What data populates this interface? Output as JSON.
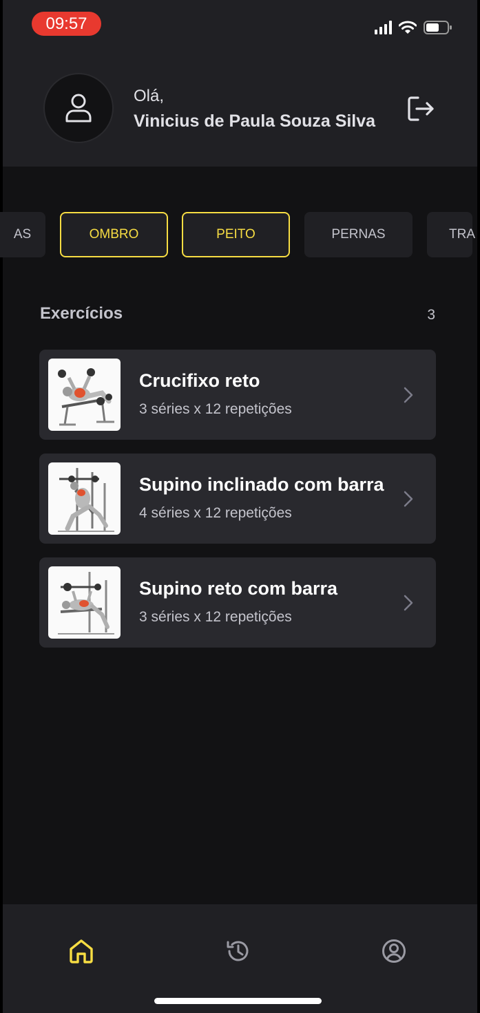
{
  "status_bar": {
    "time": "09:57"
  },
  "header": {
    "greeting": "Olá,",
    "user_name": "Vinicius de Paula Souza Silva"
  },
  "groups": [
    {
      "label": "AS",
      "active": false
    },
    {
      "label": "OMBRO",
      "active": true
    },
    {
      "label": "PEITO",
      "active": true
    },
    {
      "label": "PERNAS",
      "active": false
    },
    {
      "label": "TRA",
      "active": false
    }
  ],
  "exercises": {
    "title": "Exercícios",
    "count": "3",
    "items": [
      {
        "name": "Crucifixo reto",
        "detail": "3 séries x 12 repetições"
      },
      {
        "name": "Supino inclinado com barra",
        "detail": "4 séries x 12 repetições"
      },
      {
        "name": "Supino reto com barra",
        "detail": "3 séries x 12 repetições"
      }
    ]
  },
  "colors": {
    "accent": "#f7dd43",
    "background": "#121214",
    "surface": "#202024",
    "card": "#29292e",
    "time_pill": "#e8392f"
  },
  "icons": [
    "user-icon",
    "logout-icon",
    "chevron-right-icon",
    "home-icon",
    "history-icon",
    "profile-icon",
    "signal-icon",
    "wifi-icon",
    "battery-icon"
  ]
}
